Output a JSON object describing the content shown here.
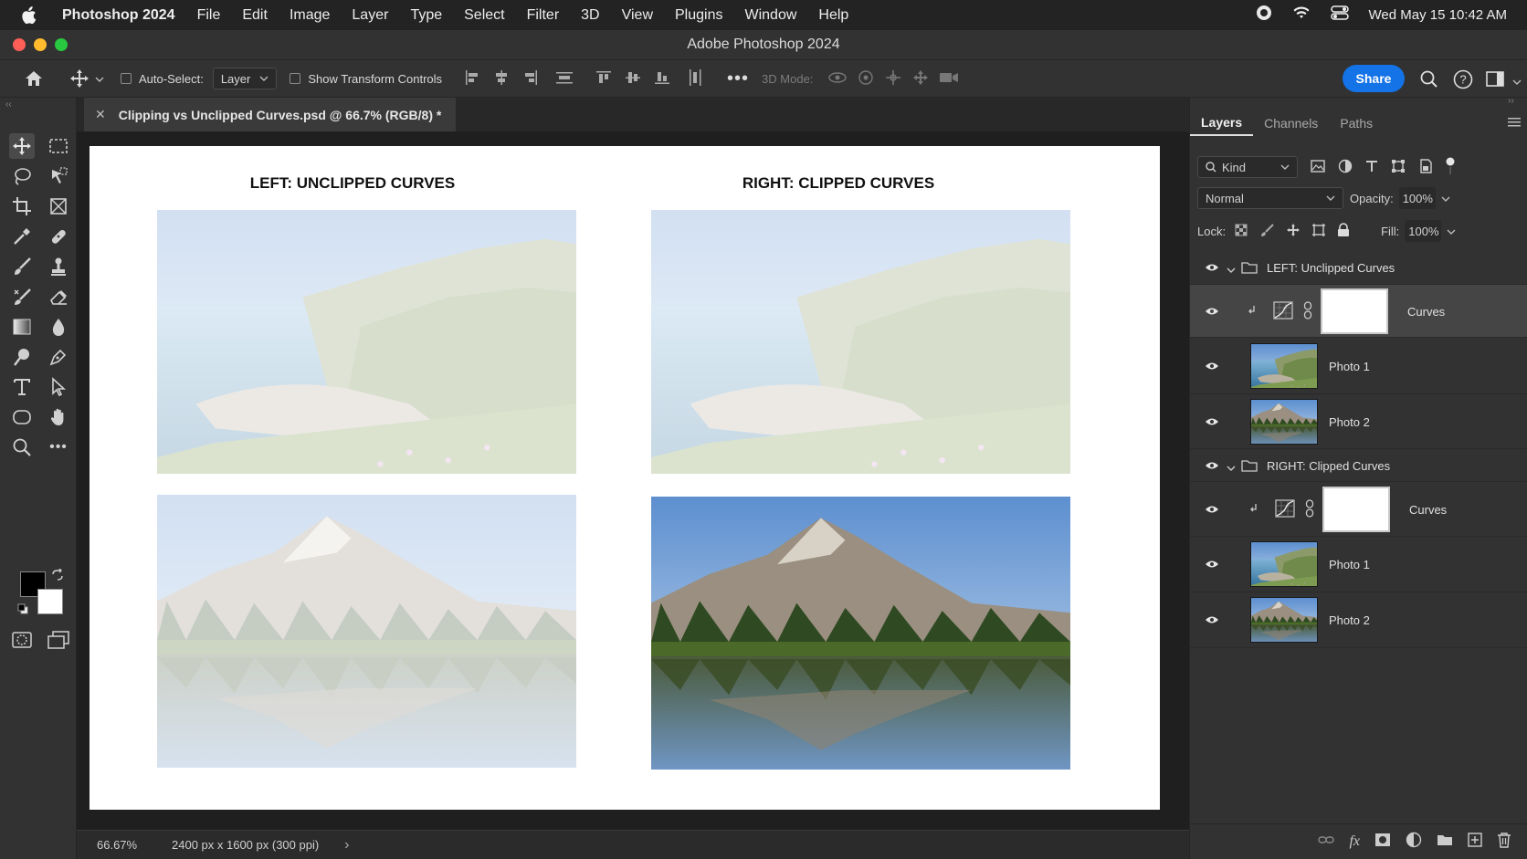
{
  "menubar": {
    "app_name": "Photoshop 2024",
    "items": [
      "File",
      "Edit",
      "Image",
      "Layer",
      "Type",
      "Select",
      "Filter",
      "3D",
      "View",
      "Plugins",
      "Window",
      "Help"
    ],
    "clock": "Wed May 15  10:42 AM"
  },
  "window": {
    "title": "Adobe Photoshop 2024"
  },
  "options": {
    "auto_select_label": "Auto-Select:",
    "auto_select_target": "Layer",
    "show_transform_label": "Show Transform Controls",
    "mode_3d_label": "3D Mode:",
    "share_label": "Share"
  },
  "document": {
    "tab_title": "Clipping vs Unclipped Curves.psd @ 66.7% (RGB/8) *",
    "heading_left": "LEFT: UNCLIPPED CURVES",
    "heading_right": "RIGHT: CLIPPED CURVES"
  },
  "status": {
    "zoom": "66.67%",
    "doc_info": "2400 px x 1600 px (300 ppi)"
  },
  "panel": {
    "tabs": [
      "Layers",
      "Channels",
      "Paths"
    ],
    "filter_kind": "Kind",
    "blend_mode": "Normal",
    "opacity_label": "Opacity:",
    "opacity_value": "100%",
    "lock_label": "Lock:",
    "fill_label": "Fill:",
    "fill_value": "100%",
    "layers": [
      {
        "type": "group",
        "name": "LEFT: Unclipped Curves"
      },
      {
        "type": "adjustment",
        "name": "Curves"
      },
      {
        "type": "pixel",
        "name": "Photo 1"
      },
      {
        "type": "pixel",
        "name": "Photo 2"
      },
      {
        "type": "group",
        "name": "RIGHT: Clipped Curves"
      },
      {
        "type": "adjustment",
        "name": "Curves"
      },
      {
        "type": "pixel",
        "name": "Photo 1"
      },
      {
        "type": "pixel",
        "name": "Photo 2"
      }
    ]
  },
  "colors": {
    "accent": "#1473e6",
    "panel_bg": "#323232",
    "foreground_swatch": "#000000",
    "background_swatch": "#ffffff"
  }
}
